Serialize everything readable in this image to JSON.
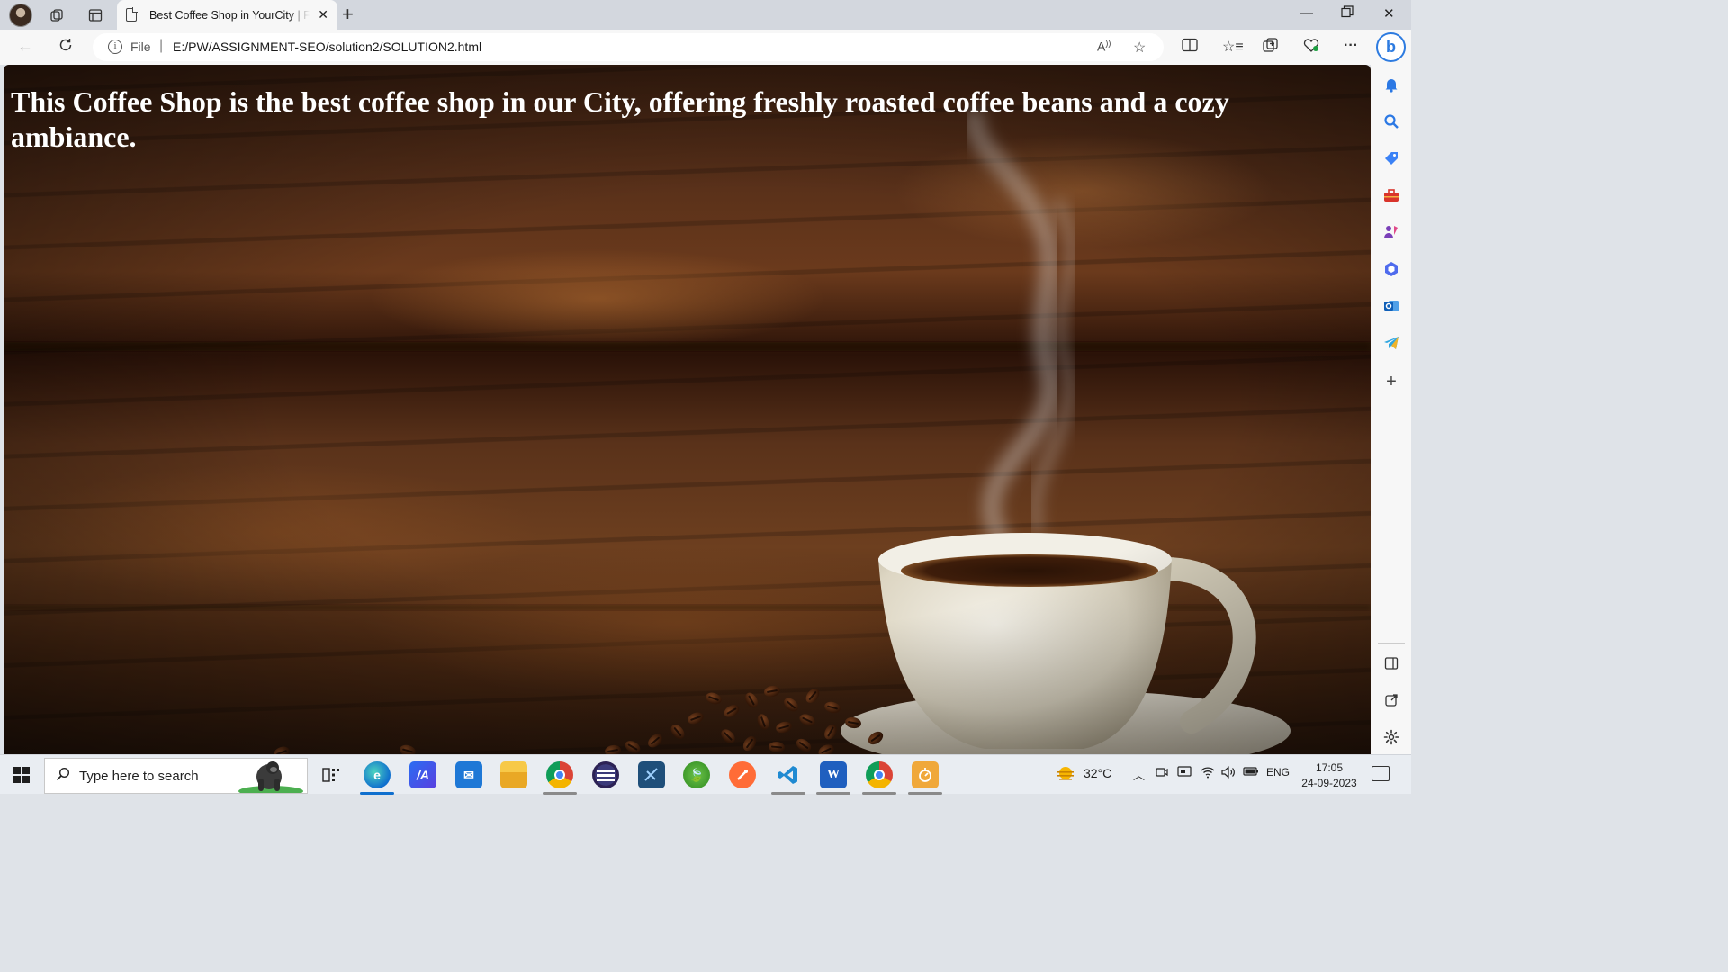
{
  "browser": {
    "tab_title": "Best Coffee Shop in YourCity | Freshly Roasted Coffee Beans",
    "address_scheme": "File",
    "address_url": "E:/PW/ASSIGNMENT-SEO/solution2/SOLUTION2.html",
    "bing_label": "b"
  },
  "page": {
    "heading": "This Coffee Shop is the best coffee shop in our City, offering freshly roasted coffee beans and a cozy ambiance."
  },
  "taskbar": {
    "search_placeholder": "Type here to search",
    "weather": "32°C",
    "language": "ENG",
    "time": "17:05",
    "date": "24-09-2023",
    "pinned_apps": [
      "task-view",
      "edge",
      "jetbrains",
      "mail",
      "file-explorer",
      "chrome-profile",
      "eclipse",
      "mysql-workbench",
      "spring-tool-suite",
      "postman",
      "vscode",
      "word",
      "chrome",
      "notes"
    ]
  },
  "sidebar": {
    "items": [
      "bell-icon",
      "search-icon",
      "shopping-tag-icon",
      "toolbox-icon",
      "games-icon",
      "microsoft-365-icon",
      "outlook-icon",
      "telegram-icon",
      "add-icon",
      "split-view-icon",
      "open-external-icon",
      "settings-icon"
    ]
  }
}
